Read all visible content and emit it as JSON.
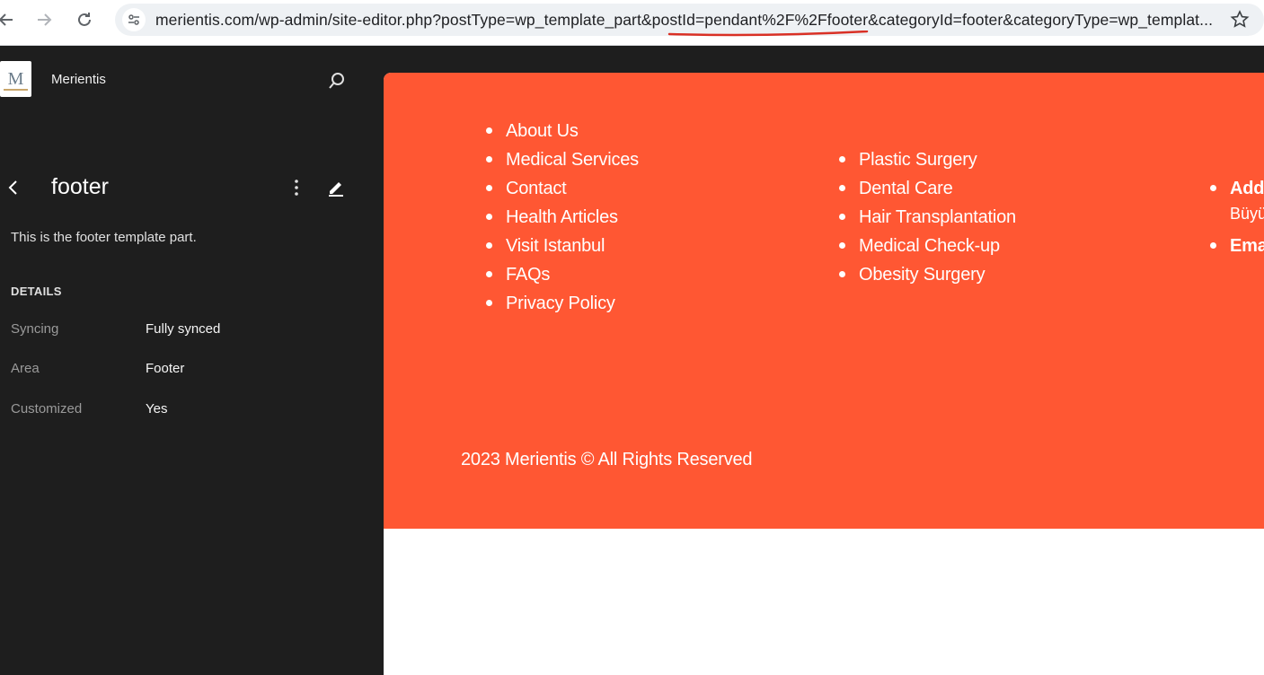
{
  "browser": {
    "url": "merientis.com/wp-admin/site-editor.php?postType=wp_template_part&postId=pendant%2F%2Ffooter&categoryId=footer&categoryType=wp_templat...",
    "annotation_color": "#d93025"
  },
  "sidebar": {
    "site_name": "Merientis",
    "logo_letter": "M",
    "title": "footer",
    "description": "This is the footer template part.",
    "details_heading": "DETAILS",
    "details": [
      {
        "label": "Syncing",
        "value": "Fully synced"
      },
      {
        "label": "Area",
        "value": "Footer"
      },
      {
        "label": "Customized",
        "value": "Yes"
      }
    ]
  },
  "footer": {
    "background": "#ff5733",
    "menu_pages": [
      "About Us",
      "Medical Services",
      "Contact",
      "Health Articles",
      "Visit Istanbul",
      "FAQs",
      "Privacy Policy"
    ],
    "menu_services": [
      "Plastic Surgery",
      "Dental Care",
      "Hair Transplantation",
      "Medical Check-up",
      "Obesity Surgery"
    ],
    "contact_items": [
      "Addr",
      "Ema"
    ],
    "contact_sub": "Büyü",
    "copyright": "2023 Merientis © All Rights Reserved"
  }
}
